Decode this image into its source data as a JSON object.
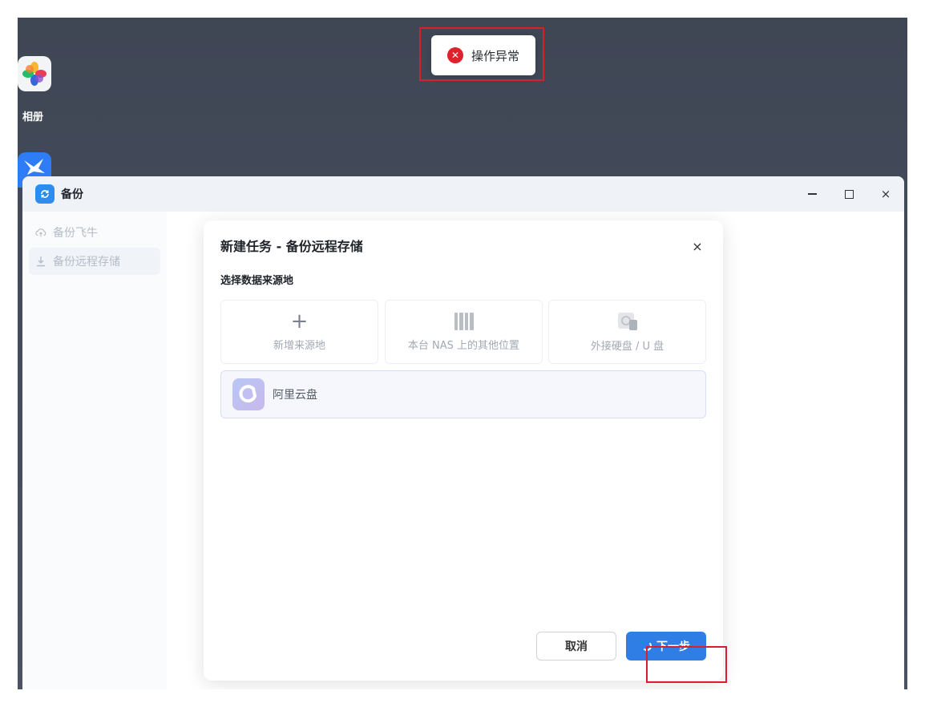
{
  "desktop": {
    "photos_label": "相册"
  },
  "toast": {
    "message": "操作异常",
    "error_color": "#e0202b"
  },
  "window": {
    "title": "备份",
    "accent": "#2d8cf0",
    "controls": {
      "minimize": "minimize",
      "maximize": "maximize",
      "close": "×"
    }
  },
  "sidebar": {
    "items": [
      {
        "label": "备份飞牛",
        "icon": "cloud-upload-icon",
        "active": false
      },
      {
        "label": "备份远程存储",
        "icon": "download-icon",
        "active": true
      }
    ]
  },
  "dialog": {
    "title": "新建任务 - 备份远程存储",
    "close": "×",
    "section_label": "选择数据来源地",
    "sources": [
      {
        "label": "新增来源地",
        "icon": "plus-icon"
      },
      {
        "label": "本台 NAS 上的其他位置",
        "icon": "nas-icon"
      },
      {
        "label": "外接硬盘 / U 盘",
        "icon": "usb-drive-icon"
      }
    ],
    "selected_source": {
      "label": "阿里云盘",
      "icon": "aliyun-drive-icon"
    },
    "cancel_label": "取消",
    "next_label": "下一步",
    "primary_color": "#2f7ee6"
  }
}
